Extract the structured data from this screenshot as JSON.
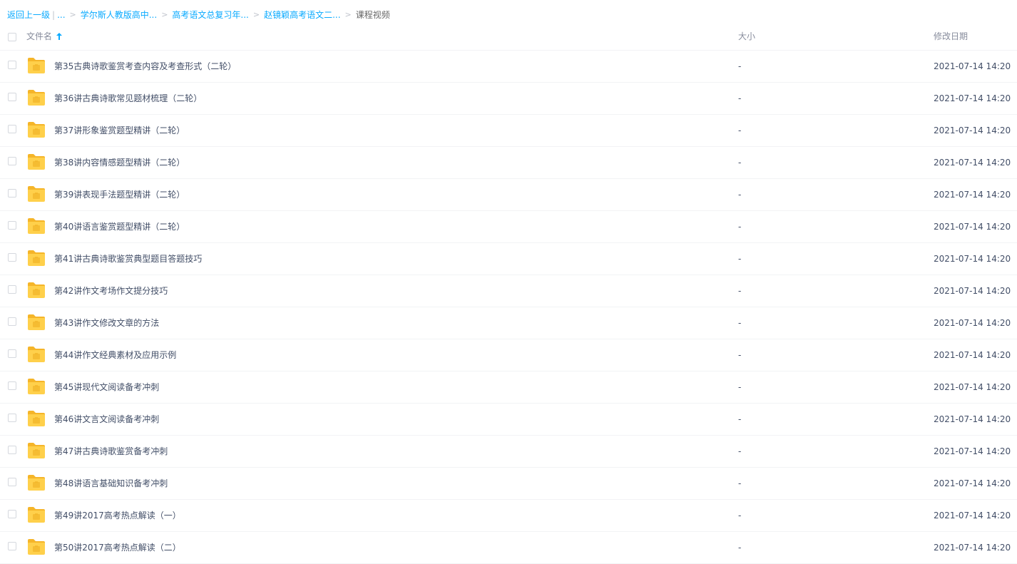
{
  "breadcrumb": {
    "back": "返回上一级",
    "separator_bar": "|",
    "ellipsis": "...",
    "items": [
      "学尔斯人教版高中...",
      "高考语文总复习年...",
      "赵镜颖高考语文二..."
    ],
    "current": "课程视频",
    "arrow": ">"
  },
  "header": {
    "name": "文件名",
    "size": "大小",
    "date": "修改日期",
    "sort": "ascending"
  },
  "colors": {
    "link": "#09aaff",
    "text": "#424e67",
    "folder": "#ffd04b"
  },
  "files": [
    {
      "name": "第35古典诗歌鉴赏考查内容及考查形式（二轮）",
      "size": "-",
      "date": "2021-07-14 14:20"
    },
    {
      "name": "第36讲古典诗歌常见题材梳理（二轮）",
      "size": "-",
      "date": "2021-07-14 14:20"
    },
    {
      "name": "第37讲形象鉴赏题型精讲（二轮）",
      "size": "-",
      "date": "2021-07-14 14:20"
    },
    {
      "name": "第38讲内容情感题型精讲（二轮）",
      "size": "-",
      "date": "2021-07-14 14:20"
    },
    {
      "name": "第39讲表现手法题型精讲（二轮）",
      "size": "-",
      "date": "2021-07-14 14:20"
    },
    {
      "name": "第40讲语言鉴赏题型精讲（二轮）",
      "size": "-",
      "date": "2021-07-14 14:20"
    },
    {
      "name": "第41讲古典诗歌鉴赏典型题目答题技巧",
      "size": "-",
      "date": "2021-07-14 14:20"
    },
    {
      "name": "第42讲作文考场作文提分技巧",
      "size": "-",
      "date": "2021-07-14 14:20"
    },
    {
      "name": "第43讲作文修改文章的方法",
      "size": "-",
      "date": "2021-07-14 14:20"
    },
    {
      "name": "第44讲作文经典素材及应用示例",
      "size": "-",
      "date": "2021-07-14 14:20"
    },
    {
      "name": "第45讲现代文阅读备考冲刺",
      "size": "-",
      "date": "2021-07-14 14:20"
    },
    {
      "name": "第46讲文言文阅读备考冲刺",
      "size": "-",
      "date": "2021-07-14 14:20"
    },
    {
      "name": "第47讲古典诗歌鉴赏备考冲刺",
      "size": "-",
      "date": "2021-07-14 14:20"
    },
    {
      "name": "第48讲语言基础知识备考冲刺",
      "size": "-",
      "date": "2021-07-14 14:20"
    },
    {
      "name": "第49讲2017高考热点解读（一）",
      "size": "-",
      "date": "2021-07-14 14:20"
    },
    {
      "name": "第50讲2017高考热点解读（二）",
      "size": "-",
      "date": "2021-07-14 14:20"
    }
  ]
}
